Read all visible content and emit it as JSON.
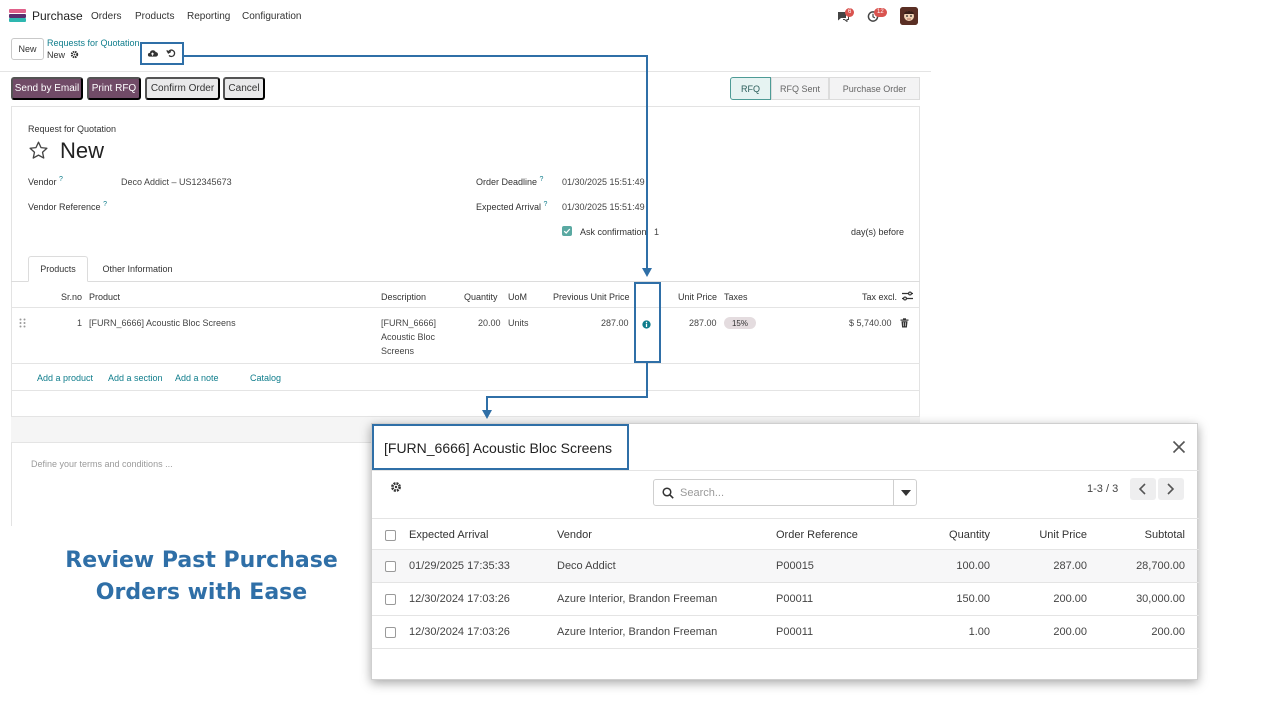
{
  "app": {
    "name": "Purchase",
    "menu": [
      "Orders",
      "Products",
      "Reporting",
      "Configuration"
    ],
    "chat_count": "6",
    "activity_count": "12",
    "colors": {
      "brand": "#714b67",
      "link": "#0f7d8c",
      "callout": "#2f6fa7"
    }
  },
  "breadcrumb": {
    "new_label": "New",
    "parent": "Requests for Quotation",
    "current": "New"
  },
  "actions": {
    "send_email": "Send by Email",
    "print_rfq": "Print RFQ",
    "confirm": "Confirm Order",
    "cancel": "Cancel"
  },
  "status": [
    "RFQ",
    "RFQ Sent",
    "Purchase Order"
  ],
  "form": {
    "doc_type": "Request for Quotation",
    "name": "New",
    "vendor_label": "Vendor",
    "vendor_value": "Deco Addict – US12345673",
    "vendor_ref_label": "Vendor Reference",
    "order_deadline_label": "Order Deadline",
    "order_deadline_value": "01/30/2025 15:51:49",
    "expected_arrival_label": "Expected Arrival",
    "expected_arrival_value": "01/30/2025 15:51:49",
    "ask_confirmation_label": "Ask confirmation",
    "ask_confirmation_days": "1",
    "days_before": "day(s) before",
    "qmark": "?"
  },
  "tabs": [
    "Products",
    "Other Information"
  ],
  "lines": {
    "headers": {
      "srno": "Sr.no",
      "product": "Product",
      "description": "Description",
      "quantity": "Quantity",
      "uom": "UoM",
      "prev_price": "Previous Unit Price",
      "unit_price": "Unit Price",
      "taxes": "Taxes",
      "tax_excl": "Tax excl."
    },
    "row": {
      "srno": "1",
      "product": "[FURN_6666] Acoustic Bloc Screens",
      "description": [
        "[FURN_6666]",
        "Acoustic Bloc",
        "Screens"
      ],
      "quantity": "20.00",
      "uom": "Units",
      "prev_price": "287.00",
      "unit_price": "287.00",
      "tax": "15%",
      "subtotal": "$ 5,740.00"
    },
    "links": [
      "Add a product",
      "Add a section",
      "Add a note",
      "Catalog"
    ]
  },
  "terms_placeholder": "Define your terms and conditions ...",
  "promo": [
    "Review Past Purchase",
    "Orders with Ease"
  ],
  "dialog": {
    "title": "[FURN_6666] Acoustic Bloc Screens",
    "search_placeholder": "Search...",
    "pager": "1-3 / 3",
    "headers": {
      "expected_arrival": "Expected Arrival",
      "vendor": "Vendor",
      "order_ref": "Order Reference",
      "quantity": "Quantity",
      "unit_price": "Unit Price",
      "subtotal": "Subtotal"
    },
    "rows": [
      {
        "date": "01/29/2025 17:35:33",
        "vendor": "Deco Addict",
        "ref": "P00015",
        "qty": "100.00",
        "price": "287.00",
        "subtotal": "28,700.00"
      },
      {
        "date": "12/30/2024 17:03:26",
        "vendor": "Azure Interior, Brandon Freeman",
        "ref": "P00011",
        "qty": "150.00",
        "price": "200.00",
        "subtotal": "30,000.00"
      },
      {
        "date": "12/30/2024 17:03:26",
        "vendor": "Azure Interior, Brandon Freeman",
        "ref": "P00011",
        "qty": "1.00",
        "price": "200.00",
        "subtotal": "200.00"
      }
    ]
  }
}
